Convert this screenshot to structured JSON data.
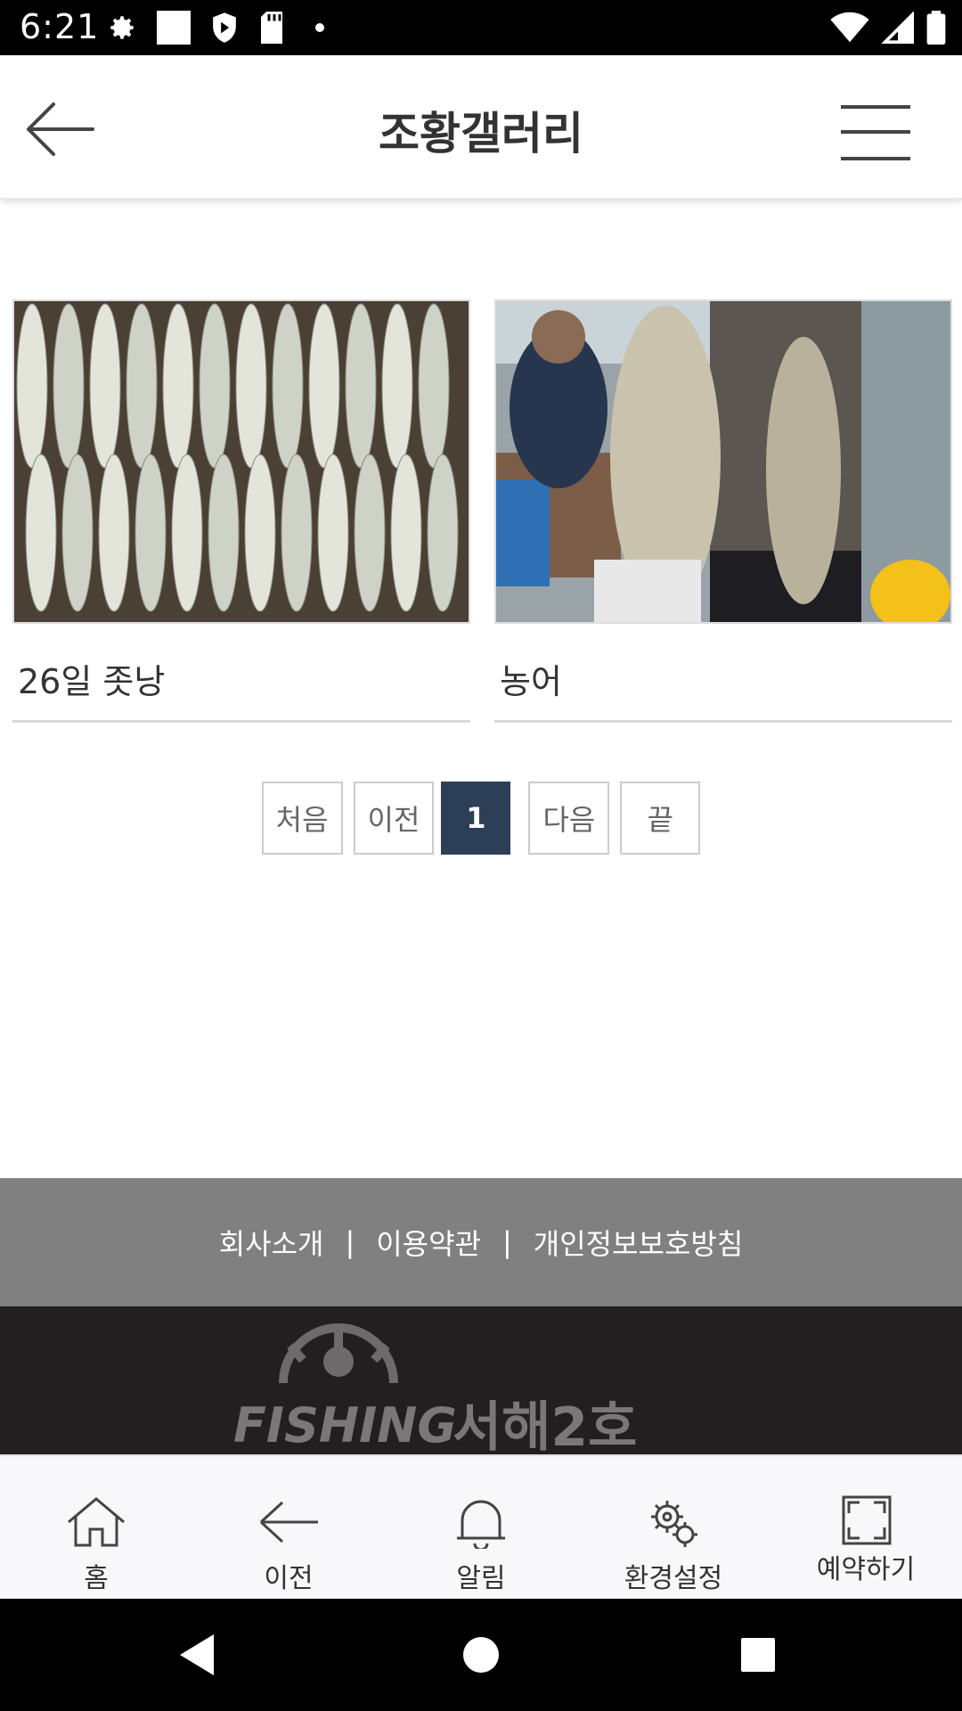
{
  "status_bar": {
    "time": "6:21",
    "icons_left": [
      "gear-icon",
      "white-square-icon",
      "shield-icon",
      "sd-card-icon",
      "dot-icon"
    ],
    "icons_right": [
      "wifi-icon",
      "signal-icon",
      "battery-icon"
    ]
  },
  "header": {
    "title": "조황갤러리",
    "back_icon": "arrow-left-icon",
    "menu_icon": "hamburger-menu-icon"
  },
  "gallery": {
    "items": [
      {
        "caption": "26일 좃낭",
        "image": "fish-catch-photo"
      },
      {
        "caption": "농어",
        "image": "sea-bass-photo"
      }
    ]
  },
  "pagination": {
    "first": "처음",
    "prev": "이전",
    "current": "1",
    "next": "다음",
    "last": "끝"
  },
  "footer": {
    "links": [
      "회사소개",
      "이용약관",
      "개인정보보호방침"
    ],
    "separator": "|",
    "logo_text_en": "FISHING",
    "logo_text_ko": "서해2호"
  },
  "bottom_nav": {
    "items": [
      {
        "label": "홈",
        "icon": "home-icon"
      },
      {
        "label": "이전",
        "icon": "arrow-left-icon"
      },
      {
        "label": "알림",
        "icon": "bell-icon"
      },
      {
        "label": "환경설정",
        "icon": "gears-icon"
      },
      {
        "label": "예약하기",
        "icon": "fullscreen-icon"
      }
    ]
  },
  "colors": {
    "active_page": "#2d3e57",
    "footer_links_bg": "#808080",
    "footer_logo_bg": "#231f20"
  }
}
